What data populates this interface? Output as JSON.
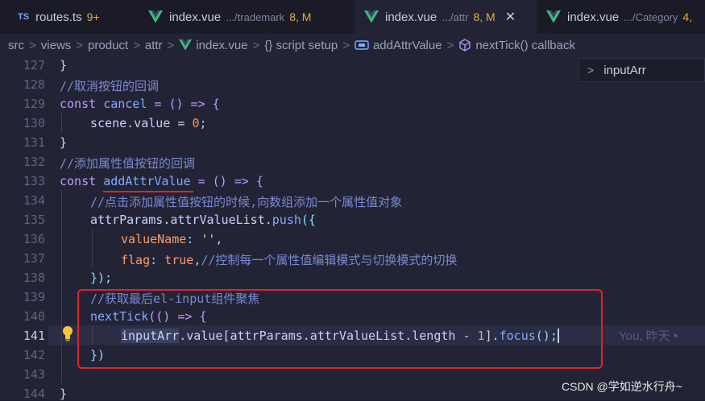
{
  "tabs": [
    {
      "icon": "typescript-icon",
      "badge": "TS",
      "name": "routes.ts",
      "meta": "",
      "status": "9+",
      "active": false
    },
    {
      "icon": "vue-icon",
      "name": "index.vue",
      "meta": ".../trademark",
      "status": "8, M",
      "active": false
    },
    {
      "icon": "vue-icon",
      "name": "index.vue",
      "meta": ".../attr",
      "status": "8, M",
      "active": true,
      "close": "✕"
    },
    {
      "icon": "vue-icon",
      "name": "index.vue",
      "meta": ".../Category",
      "status": "4,",
      "active": false
    }
  ],
  "breadcrumb": {
    "items": [
      "src",
      "views",
      "product",
      "attr",
      "index.vue",
      "{} script setup",
      "addAttrValue",
      "nextTick() callback"
    ],
    "separator": ">"
  },
  "find_widget": {
    "chevron": ">",
    "value": "inputArr"
  },
  "line_numbers": [
    "127",
    "128",
    "129",
    "130",
    "131",
    "132",
    "133",
    "134",
    "135",
    "136",
    "137",
    "138",
    "139",
    "140",
    "141",
    "142",
    "143",
    "144"
  ],
  "current_line": "141",
  "code": {
    "l127": "}",
    "l128": "//取消按钮的回调",
    "l129_kw": "const",
    "l129_fn": "cancel",
    "l129_rest": " = () => {",
    "l130_var": "scene",
    "l130_rest": ".value = ",
    "l130_num": "0",
    "l130_end": ";",
    "l131": "}",
    "l132": "//添加属性值按钮的回调",
    "l133_kw": "const",
    "l133_fn": "addAttrValue",
    "l133_rest": " = () => {",
    "l134": "//点击添加属性值按钮的时候,向数组添加一个属性值对象",
    "l135_var": "attrParams",
    "l135_mid": ".attrValueList.",
    "l135_fn": "push",
    "l135_end": "({",
    "l136_prop": "valueName",
    "l136_rest": ": ",
    "l136_str": "''",
    "l136_end": ",",
    "l137_prop": "flag",
    "l137_rest": ": ",
    "l137_bool": "true",
    "l137_end": ",",
    "l137_cmt": "//控制每一个属性值编辑模式与切换模式的切换",
    "l138": "});",
    "l139": "//获取最后el-input组件聚焦",
    "l140_fn": "nextTick",
    "l140_rest": "(() => {",
    "l141_var": "inputArr",
    "l141_a": ".value[",
    "l141_b": "attrParams",
    "l141_c": ".attrValueList.length - ",
    "l141_num": "1",
    "l141_d": "].",
    "l141_fn": "focus",
    "l141_end": "();",
    "l142": "})",
    "l144": "}"
  },
  "blame": "You, 昨天 •",
  "watermark": "CSDN @学如逆水行舟~",
  "colors": {
    "annotation": "#e5202e",
    "background": "#222436",
    "keyword": "#c099ff",
    "function": "#82aaff",
    "comment": "#7a88cf"
  }
}
